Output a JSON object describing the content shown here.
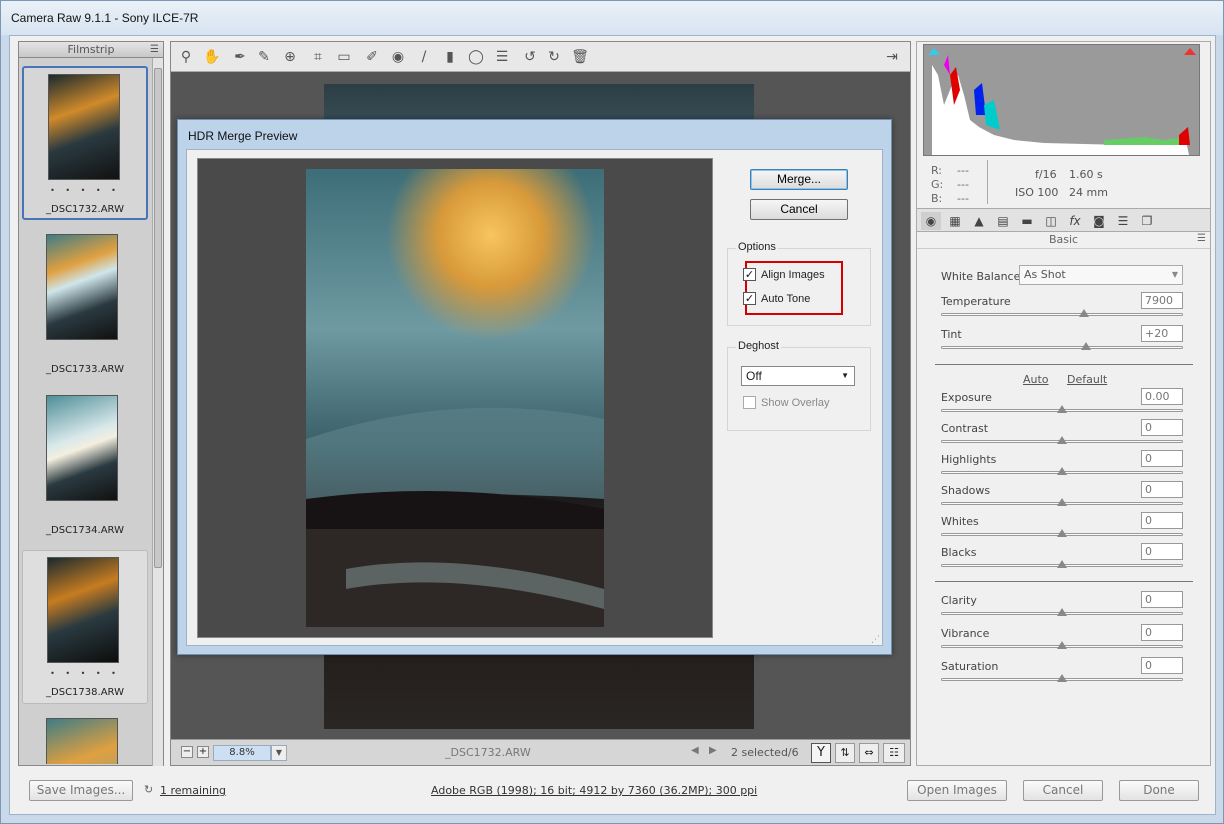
{
  "window": {
    "title": "Camera Raw 9.1.1  -  Sony ILCE-7R"
  },
  "filmstrip": {
    "header": "Filmstrip",
    "menu_icon": "list-menu-icon",
    "items": [
      {
        "name": "_DSC1732.ARW",
        "dots": "• • • • •"
      },
      {
        "name": "_DSC1733.ARW",
        "dots": ""
      },
      {
        "name": "_DSC1734.ARW",
        "dots": ""
      },
      {
        "name": "_DSC1738.ARW",
        "dots": "• • • • •"
      }
    ]
  },
  "toolbar": {
    "tools": [
      "zoom-icon",
      "hand-icon",
      "white-balance-icon",
      "color-sampler-icon",
      "target-adjust-icon",
      "crop-icon",
      "straighten-icon",
      "spot-removal-icon",
      "red-eye-icon",
      "adjustment-brush-icon",
      "graduated-filter-icon",
      "radial-filter-icon",
      "list-icon",
      "rotate-left-icon",
      "rotate-right-icon",
      "trash-icon"
    ]
  },
  "status": {
    "zoom": "8.8%",
    "filename": "_DSC1732.ARW",
    "selected": "2 selected/6"
  },
  "info": {
    "r_label": "R:",
    "g_label": "G:",
    "b_label": "B:",
    "r": "---",
    "g": "---",
    "b": "---",
    "aperture": "f/16",
    "shutter": "1.60 s",
    "iso": "ISO 100",
    "focal": "24 mm"
  },
  "panel": {
    "title": "Basic",
    "white_balance_label": "White Balance:",
    "white_balance": "As Shot",
    "auto": "Auto",
    "default": "Default",
    "sliders_top": [
      {
        "label": "Temperature",
        "value": "7900",
        "pos": 0.59
      },
      {
        "label": "Tint",
        "value": "+20",
        "pos": 0.6
      }
    ],
    "sliders_tone": [
      {
        "label": "Exposure",
        "value": "0.00",
        "pos": 0.5
      },
      {
        "label": "Contrast",
        "value": "0",
        "pos": 0.5
      },
      {
        "label": "Highlights",
        "value": "0",
        "pos": 0.5
      },
      {
        "label": "Shadows",
        "value": "0",
        "pos": 0.5
      },
      {
        "label": "Whites",
        "value": "0",
        "pos": 0.5
      },
      {
        "label": "Blacks",
        "value": "0",
        "pos": 0.5
      }
    ],
    "sliders_presence": [
      {
        "label": "Clarity",
        "value": "0",
        "pos": 0.5
      },
      {
        "label": "Vibrance",
        "value": "0",
        "pos": 0.5
      },
      {
        "label": "Saturation",
        "value": "0",
        "pos": 0.5
      }
    ]
  },
  "bottom": {
    "save": "Save Images...",
    "remaining": "1 remaining",
    "workflow": "Adobe RGB (1998); 16 bit; 4912 by 7360 (36.2MP); 300 ppi",
    "open": "Open Images",
    "cancel": "Cancel",
    "done": "Done"
  },
  "dialog": {
    "title": "HDR Merge Preview",
    "merge": "Merge...",
    "cancel": "Cancel",
    "options_label": "Options",
    "align_images": "Align Images",
    "auto_tone": "Auto Tone",
    "deghost_label": "Deghost",
    "deghost_value": "Off",
    "show_overlay": "Show Overlay"
  }
}
